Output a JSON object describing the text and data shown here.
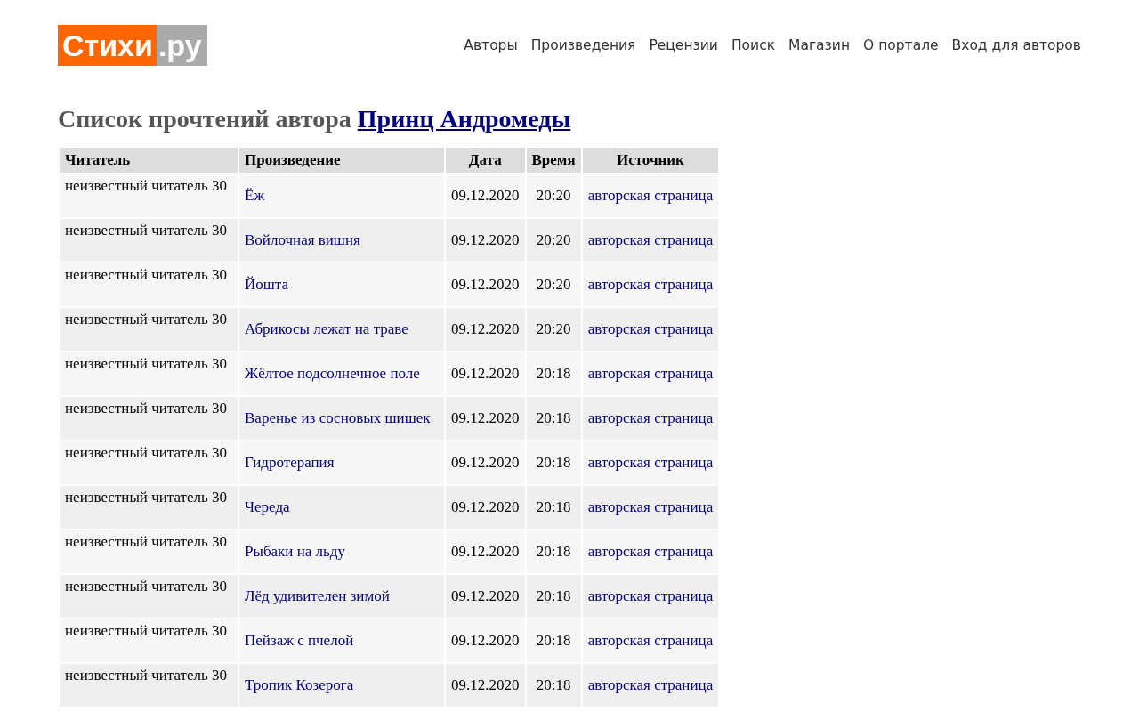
{
  "logo": {
    "main": "Стихи",
    "suffix": ".ру"
  },
  "nav": [
    "Авторы",
    "Произведения",
    "Рецензии",
    "Поиск",
    "Магазин",
    "О портале",
    "Вход для авторов"
  ],
  "heading": {
    "text": "Список прочтений автора",
    "author_link": "Принц Андромеды"
  },
  "table": {
    "columns": [
      "Читатель",
      "Произведение",
      "Дата",
      "Время",
      "Источник"
    ],
    "rows": [
      {
        "reader": "неизвестный читатель 30",
        "work": "Ёж",
        "date": "09.12.2020",
        "time": "20:20",
        "source": "авторская страница"
      },
      {
        "reader": "неизвестный читатель 30",
        "work": "Войлочная вишня",
        "date": "09.12.2020",
        "time": "20:20",
        "source": "авторская страница"
      },
      {
        "reader": "неизвестный читатель 30",
        "work": "Йошта",
        "date": "09.12.2020",
        "time": "20:20",
        "source": "авторская страница"
      },
      {
        "reader": "неизвестный читатель 30",
        "work": "Абрикосы лежат на траве",
        "date": "09.12.2020",
        "time": "20:20",
        "source": "авторская страница"
      },
      {
        "reader": "неизвестный читатель 30",
        "work": "Жёлтое подсолнечное поле",
        "date": "09.12.2020",
        "time": "20:18",
        "source": "авторская страница"
      },
      {
        "reader": "неизвестный читатель 30",
        "work": "Варенье из сосновых шишек",
        "date": "09.12.2020",
        "time": "20:18",
        "source": "авторская страница"
      },
      {
        "reader": "неизвестный читатель 30",
        "work": "Гидротерапия",
        "date": "09.12.2020",
        "time": "20:18",
        "source": "авторская страница"
      },
      {
        "reader": "неизвестный читатель 30",
        "work": "Череда",
        "date": "09.12.2020",
        "time": "20:18",
        "source": "авторская страница"
      },
      {
        "reader": "неизвестный читатель 30",
        "work": "Рыбаки на льду",
        "date": "09.12.2020",
        "time": "20:18",
        "source": "авторская страница"
      },
      {
        "reader": "неизвестный читатель 30",
        "work": "Лёд удивителен зимой",
        "date": "09.12.2020",
        "time": "20:18",
        "source": "авторская страница"
      },
      {
        "reader": "неизвестный читатель 30",
        "work": "Пейзаж с пчелой",
        "date": "09.12.2020",
        "time": "20:18",
        "source": "авторская страница"
      },
      {
        "reader": "неизвестный читатель 30",
        "work": "Тропик Козерога",
        "date": "09.12.2020",
        "time": "20:18",
        "source": "авторская страница"
      }
    ]
  }
}
